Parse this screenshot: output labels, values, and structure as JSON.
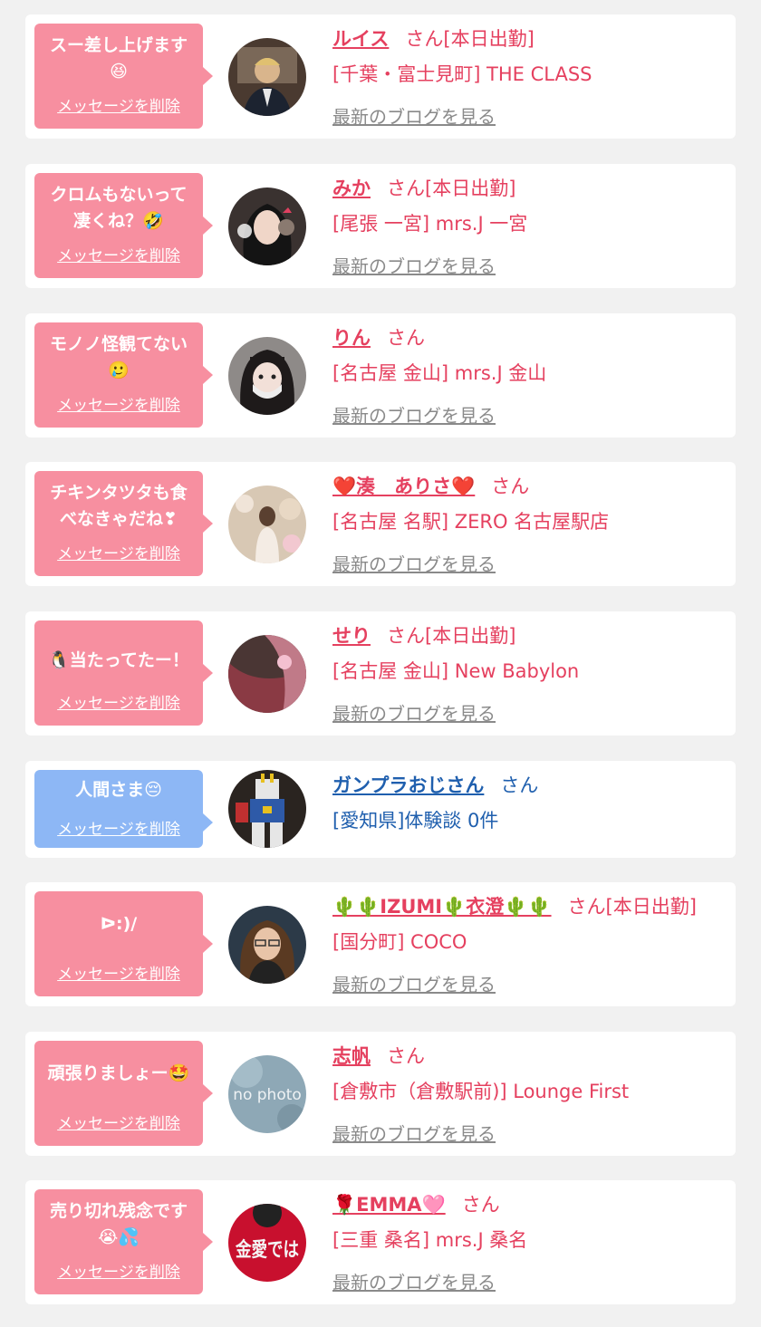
{
  "colors": {
    "pink": "#f78fa0",
    "blue_bubble": "#8db7f5",
    "name_pink": "#e5405f",
    "name_blue": "#1f5fae",
    "gray_link": "#8a8a8a"
  },
  "items": [
    {
      "message": "スー差し上げます\n😆",
      "delete_label": "メッセージを削除",
      "name": "ルイス",
      "suffix": "さん[本日出勤]",
      "shop": "[千葉・富士見町] THE CLASS",
      "blog": "最新のブログを見る"
    },
    {
      "message": "クロムもないって\n凄くね？🤣",
      "delete_label": "メッセージを削除",
      "name": "みか",
      "suffix": "さん[本日出勤]",
      "shop": "[尾張 一宮] mrs.J 一宮",
      "blog": "最新のブログを見る"
    },
    {
      "message": "モノノ怪観てない\n🥲",
      "delete_label": "メッセージを削除",
      "name": "りん",
      "suffix": "さん",
      "shop": "[名古屋 金山] mrs.J 金山",
      "blog": "最新のブログを見る"
    },
    {
      "message": "チキンタツタも食\nべなきゃだね❣",
      "delete_label": "メッセージを削除",
      "name": "❤️湊　ありさ❤️",
      "suffix": "さん",
      "shop": "[名古屋 名駅] ZERO 名古屋駅店",
      "blog": "最新のブログを見る"
    },
    {
      "message": "🐧当たってたー！",
      "delete_label": "メッセージを削除",
      "name": "せり",
      "suffix": "さん[本日出勤]",
      "shop": "[名古屋 金山] New Babylon",
      "blog": "最新のブログを見る"
    },
    {
      "message": "人間さま😔",
      "delete_label": "メッセージを削除",
      "name": "ガンプラおじさん",
      "suffix": "さん",
      "shop": "[愛知県]体験談 0件",
      "blog": ""
    },
    {
      "message": "ᐅ:)/",
      "delete_label": "メッセージを削除",
      "name": "🌵🌵IZUMI🌵衣澄🌵🌵",
      "suffix": "さん[本日出勤]",
      "shop": "[国分町] COCO",
      "blog": "最新のブログを見る"
    },
    {
      "message": "頑張りましょー🤩",
      "delete_label": "メッセージを削除",
      "name": "志帆",
      "suffix": "さん",
      "shop": "[倉敷市（倉敷駅前)] Lounge First",
      "blog": "最新のブログを見る"
    },
    {
      "message": "売り切れ残念です\n😭💦",
      "delete_label": "メッセージを削除",
      "name": "🌹EMMA🩷",
      "suffix": "さん",
      "shop": "[三重 桑名] mrs.J 桑名",
      "blog": "最新のブログを見る"
    }
  ],
  "avatar_9_text": "金愛では",
  "avatar_8_text": "no photo"
}
